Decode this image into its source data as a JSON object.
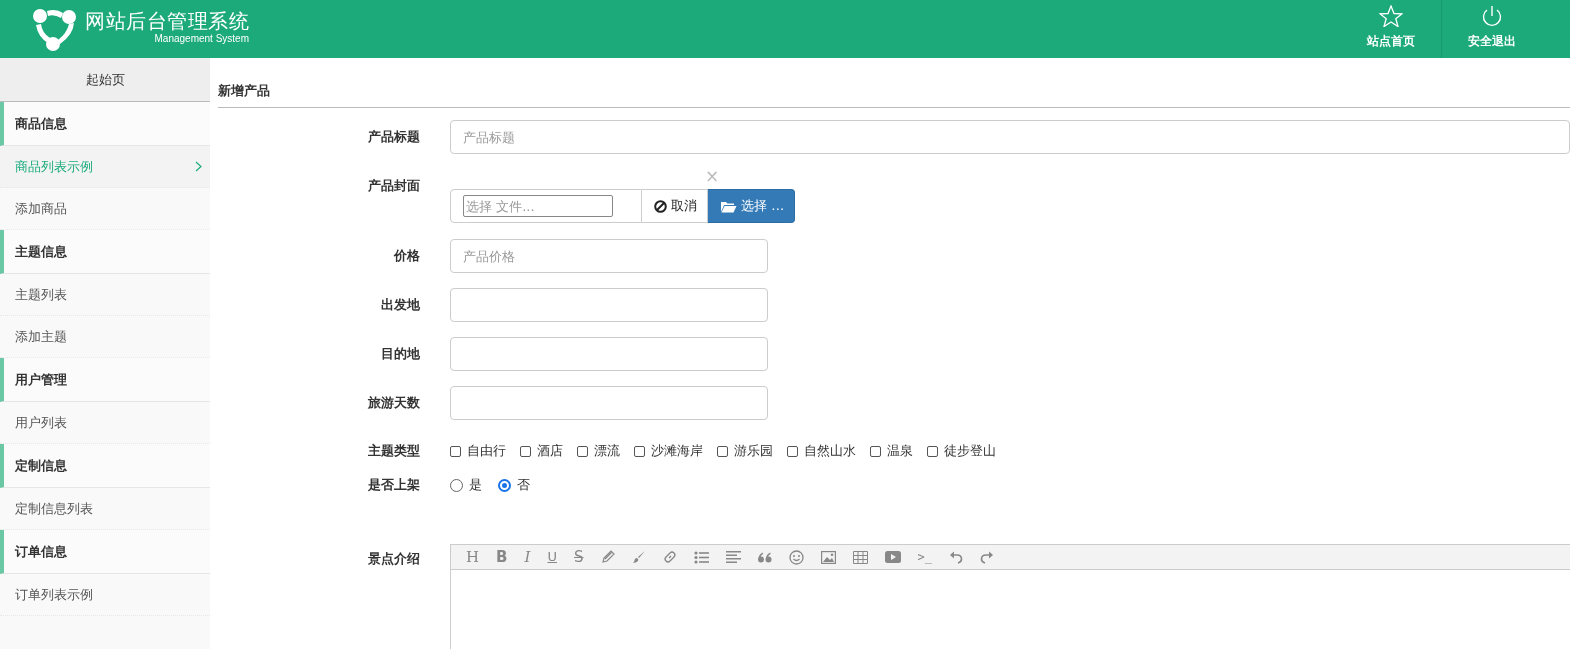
{
  "header": {
    "title": "网站后台管理系统",
    "subtitle": "Management System",
    "actions": [
      {
        "kind": "home",
        "label": "站点首页"
      },
      {
        "kind": "logout",
        "label": "安全退出"
      }
    ]
  },
  "sidebar": {
    "home": "起始页",
    "groups": [
      {
        "title": "商品信息",
        "items": [
          {
            "label": "商品列表示例",
            "selected": true
          },
          {
            "label": "添加商品",
            "selected": false
          }
        ]
      },
      {
        "title": "主题信息",
        "items": [
          {
            "label": "主题列表",
            "selected": false
          },
          {
            "label": "添加主题",
            "selected": false
          }
        ]
      },
      {
        "title": "用户管理",
        "items": [
          {
            "label": "用户列表",
            "selected": false
          }
        ]
      },
      {
        "title": "定制信息",
        "items": [
          {
            "label": "定制信息列表",
            "selected": false
          }
        ]
      },
      {
        "title": "订单信息",
        "items": [
          {
            "label": "订单列表示例",
            "selected": false
          }
        ]
      }
    ]
  },
  "form": {
    "heading": "新增产品",
    "fields": [
      {
        "kind": "text",
        "label": "产品标题",
        "placeholder": "产品标题",
        "wide": true
      },
      {
        "kind": "file",
        "label": "产品封面",
        "placeholder": "选择 文件...",
        "clear": "×",
        "cancel": "取消",
        "browse": "选择 …"
      },
      {
        "kind": "text",
        "label": "价格",
        "placeholder": "产品价格",
        "wide": false
      },
      {
        "kind": "text",
        "label": "出发地",
        "wide": false
      },
      {
        "kind": "text",
        "label": "目的地",
        "wide": false
      },
      {
        "kind": "text",
        "label": "旅游天数",
        "wide": false
      },
      {
        "kind": "checkboxes",
        "label": "主题类型",
        "options": [
          {
            "label": "自由行",
            "checked": false
          },
          {
            "label": "酒店",
            "checked": false
          },
          {
            "label": "漂流",
            "checked": false
          },
          {
            "label": "沙滩海岸",
            "checked": false
          },
          {
            "label": "游乐园",
            "checked": false
          },
          {
            "label": "自然山水",
            "checked": false
          },
          {
            "label": "温泉",
            "checked": false
          },
          {
            "label": "徒步登山",
            "checked": false
          }
        ]
      },
      {
        "kind": "radios",
        "label": "是否上架",
        "options": [
          {
            "label": "是",
            "selected": false
          },
          {
            "label": "否",
            "selected": true
          }
        ]
      },
      {
        "kind": "editor",
        "label": "景点介绍",
        "toolbar": [
          {
            "kind": "heading",
            "glyph": "H"
          },
          {
            "kind": "bold",
            "glyph": "B"
          },
          {
            "kind": "italic",
            "glyph": "I"
          },
          {
            "kind": "underline",
            "glyph": "U"
          },
          {
            "kind": "strike",
            "glyph": "S"
          },
          {
            "kind": "pencil"
          },
          {
            "kind": "brush"
          },
          {
            "kind": "link"
          },
          {
            "kind": "list"
          },
          {
            "kind": "align"
          },
          {
            "kind": "quote"
          },
          {
            "kind": "smile"
          },
          {
            "kind": "image"
          },
          {
            "kind": "table"
          },
          {
            "kind": "video"
          },
          {
            "kind": "code",
            "glyph": ">_"
          },
          {
            "kind": "undo"
          },
          {
            "kind": "redo"
          }
        ]
      }
    ]
  }
}
